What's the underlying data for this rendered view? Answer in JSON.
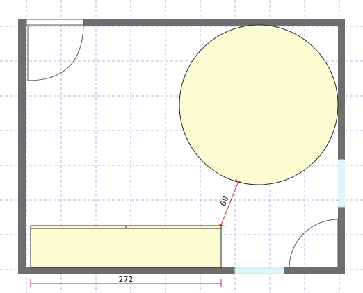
{
  "plan": {
    "dimensions": [
      {
        "id": "bench-width",
        "label": "272",
        "color": "#d42020"
      },
      {
        "id": "bench-to-table-gap",
        "label": "68",
        "color": "#d42020"
      }
    ],
    "colors": {
      "wall": "#6e6e6e",
      "furniture": "#fcfcd2",
      "window": "#ddf6fb",
      "grid": "#b4b4e6",
      "dimension": "#d42020"
    }
  }
}
